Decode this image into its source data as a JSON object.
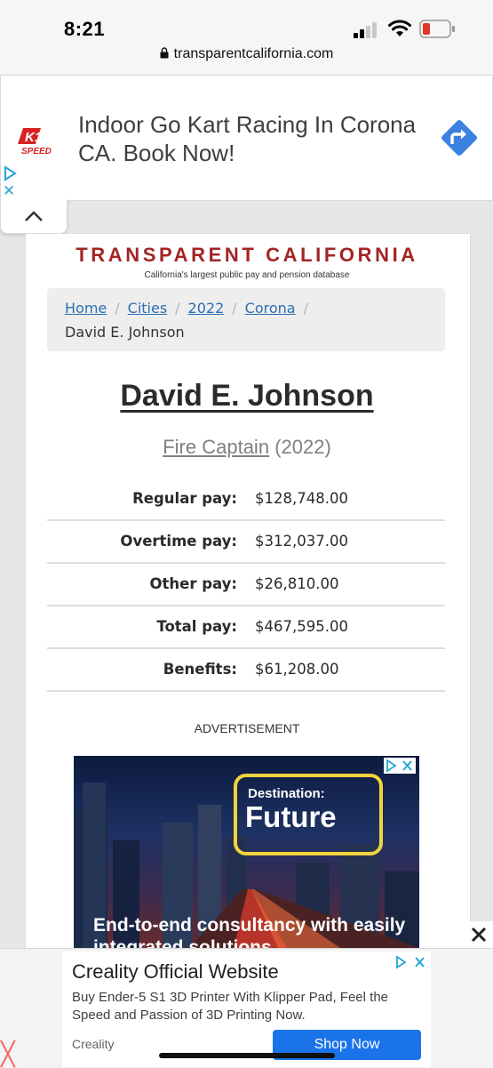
{
  "status_bar": {
    "time": "8:21",
    "url": "transparentcalifornia.com"
  },
  "top_ad": {
    "brand_logo_text": "K1 SPEED",
    "text": "Indoor Go Kart Racing In Corona CA. Book Now!",
    "icons": [
      "adchoices-icon",
      "close-icon",
      "directions-arrow-icon",
      "collapse-chevron-icon"
    ]
  },
  "site": {
    "title": "TRANSPARENT CALIFORNIA",
    "tagline": "California's largest public pay and pension database"
  },
  "breadcrumb": {
    "items": [
      "Home",
      "Cities",
      "2022",
      "Corona"
    ],
    "current": "David E. Johnson"
  },
  "employee": {
    "name": "David E. Johnson",
    "job_title": "Fire Captain",
    "year": "(2022)"
  },
  "pay": [
    {
      "label": "Regular pay:",
      "value": "$128,748.00"
    },
    {
      "label": "Overtime pay:",
      "value": "$312,037.00"
    },
    {
      "label": "Other pay:",
      "value": "$26,810.00"
    },
    {
      "label": "Total pay:",
      "value": "$467,595.00"
    },
    {
      "label": "Benefits:",
      "value": "$61,208.00"
    }
  ],
  "advertisement_label": "ADVERTISEMENT",
  "inline_ad": {
    "headline_small": "Destination:",
    "headline_large": "Future",
    "body": "End-to-end consultancy with easily integrated solutions"
  },
  "bottom_ad": {
    "title": "Creality Official Website",
    "description": "Buy Ender-5 S1 3D Printer With Klipper Pad, Feel the Speed and Passion of 3D Printing Now.",
    "source": "Creality",
    "cta": "Shop Now"
  },
  "colors": {
    "brand_red": "#a32424",
    "link_blue": "#2a6fb0",
    "ad_blue": "#1a73e8",
    "ad_yellow": "#f2d43a"
  }
}
